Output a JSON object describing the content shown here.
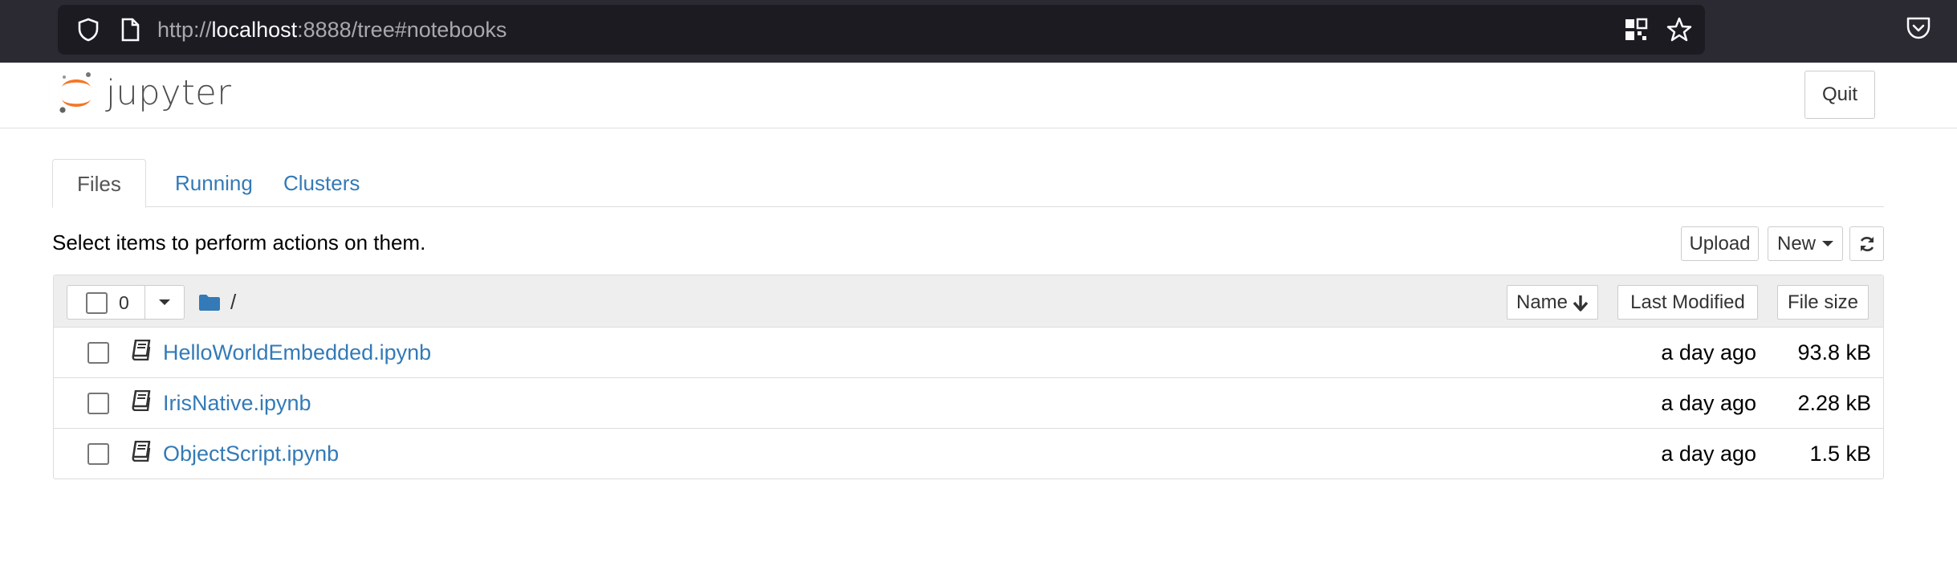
{
  "browser": {
    "url_scheme": "http://",
    "url_host": "localhost",
    "url_rest": ":8888/tree#notebooks"
  },
  "header": {
    "logo_text": "jupyter",
    "quit_label": "Quit"
  },
  "tabs": [
    {
      "label": "Files",
      "active": true
    },
    {
      "label": "Running",
      "active": false
    },
    {
      "label": "Clusters",
      "active": false
    }
  ],
  "toolbar": {
    "instruction": "Select items to perform actions on them.",
    "upload_label": "Upload",
    "new_label": "New"
  },
  "list_header": {
    "selected_count": "0",
    "breadcrumb": "/",
    "sort_name_label": "Name",
    "sort_modified_label": "Last Modified",
    "sort_size_label": "File size"
  },
  "files": [
    {
      "name": "HelloWorldEmbedded.ipynb",
      "modified": "a day ago",
      "size": "93.8 kB"
    },
    {
      "name": "IrisNative.ipynb",
      "modified": "a day ago",
      "size": "2.28 kB"
    },
    {
      "name": "ObjectScript.ipynb",
      "modified": "a day ago",
      "size": "1.5 kB"
    }
  ],
  "colors": {
    "link": "#337ab7",
    "logo_orange": "#f37726",
    "browser_bar": "#2b2a33"
  }
}
